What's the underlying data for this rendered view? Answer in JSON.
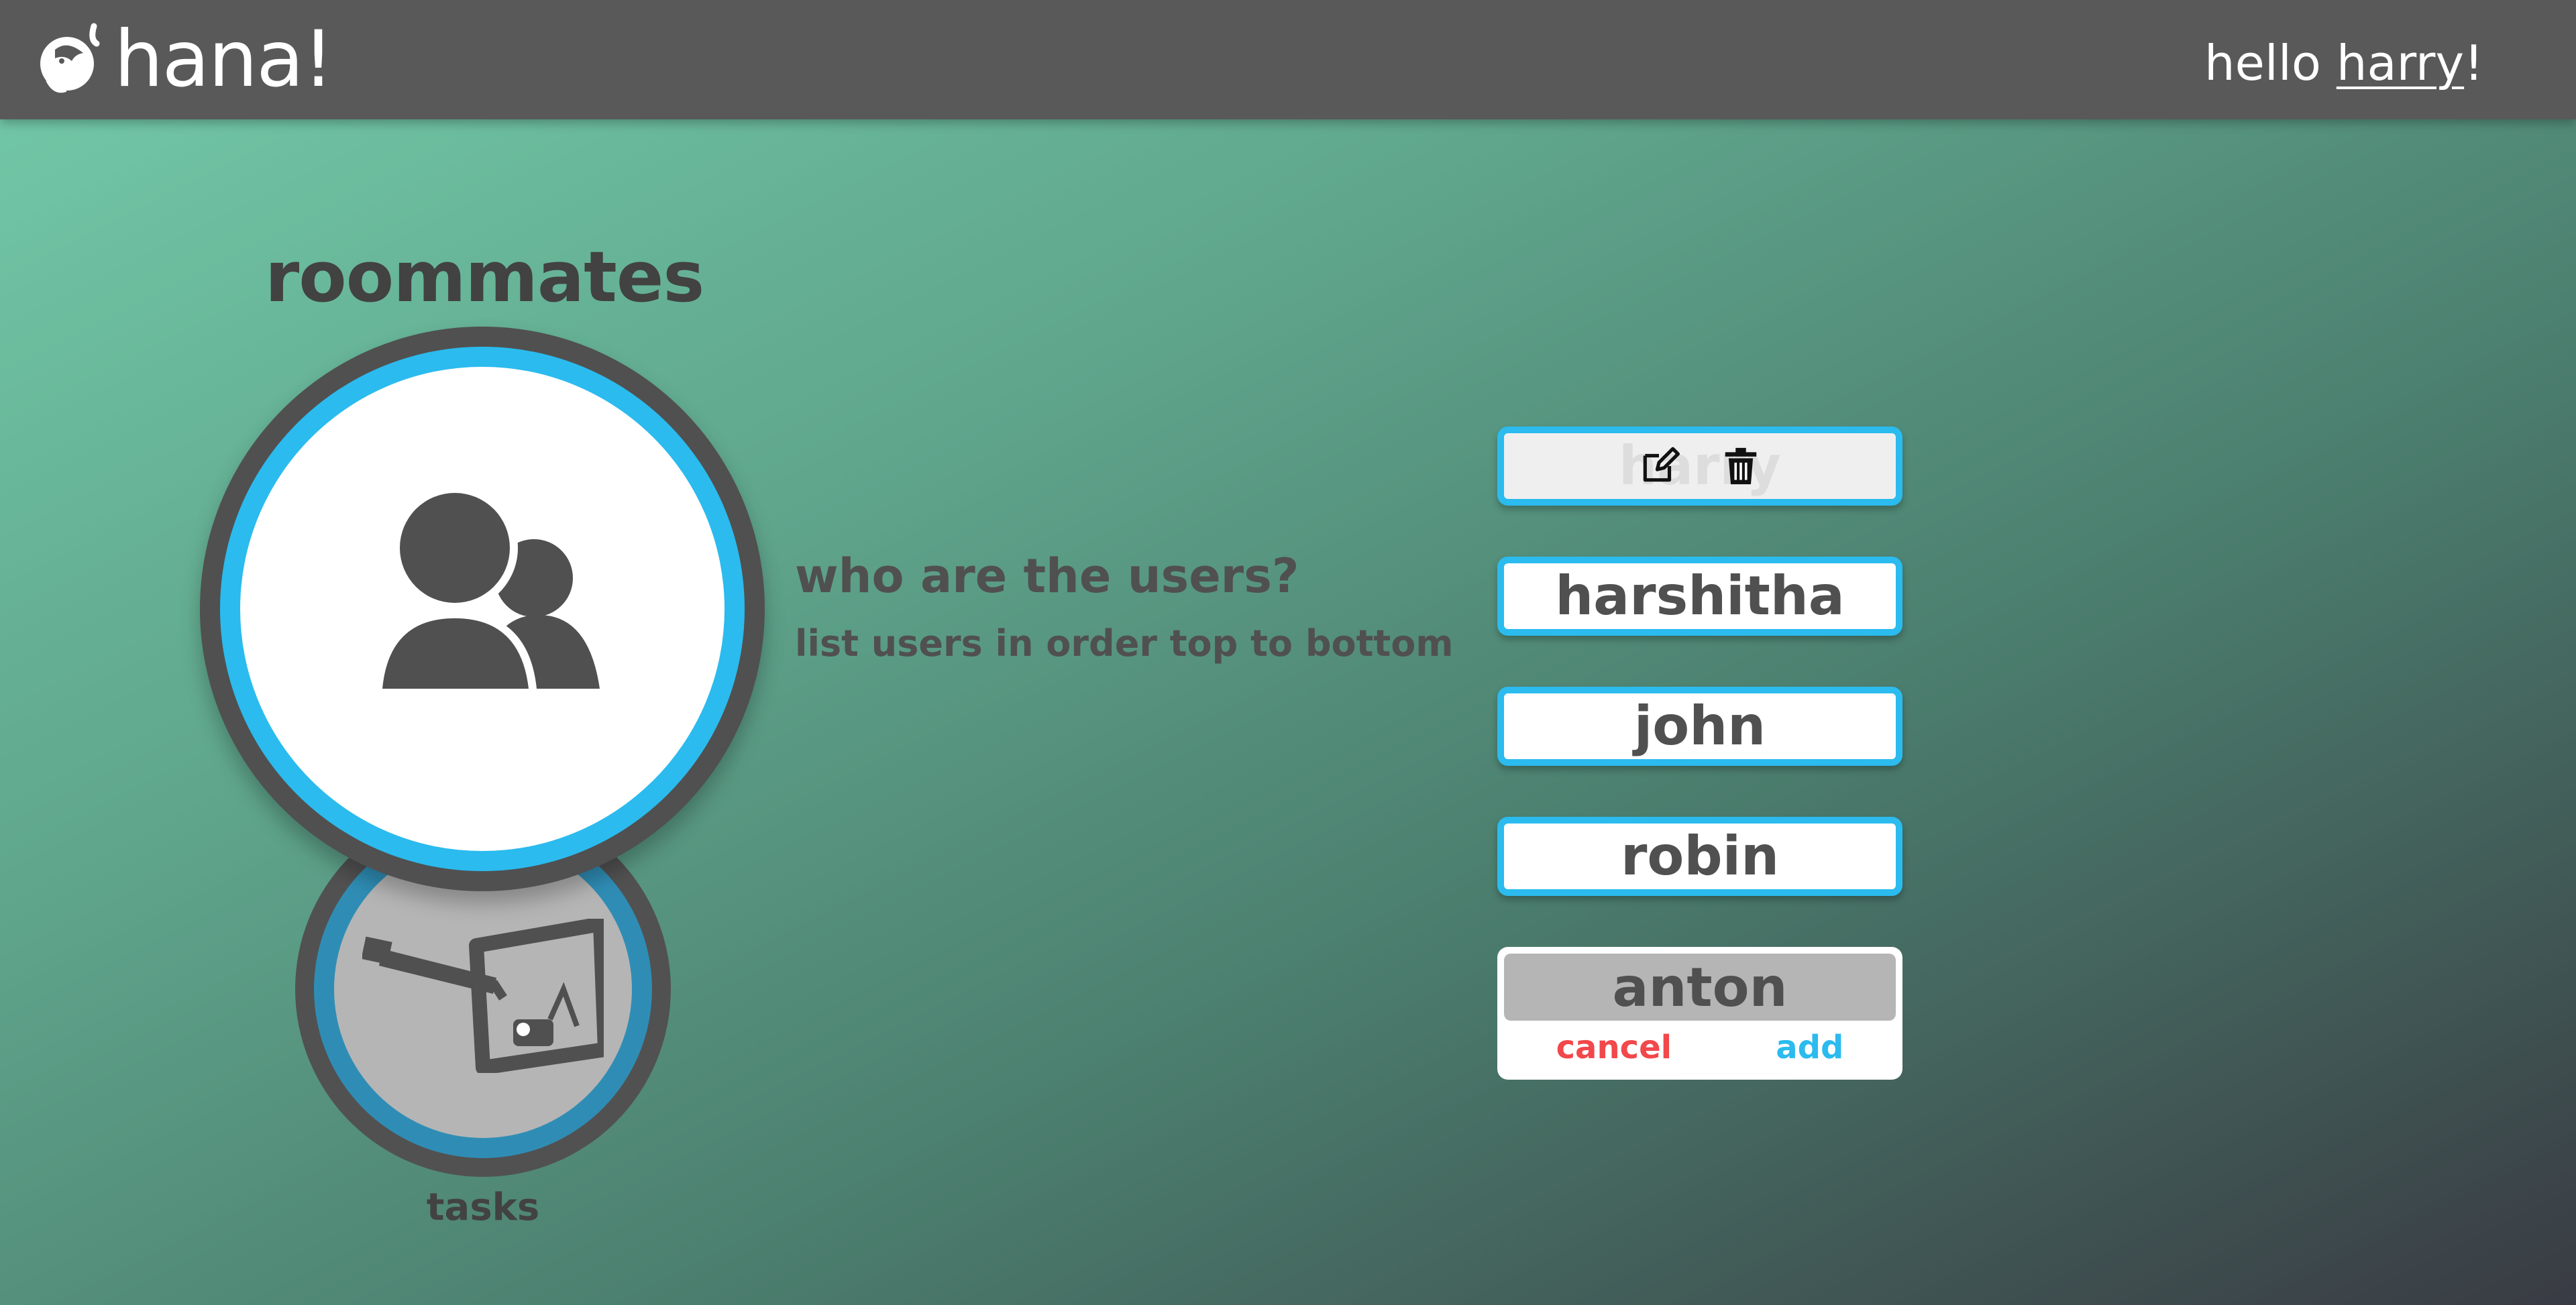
{
  "header": {
    "brand_name": "hana!",
    "greeting_prefix": "hello ",
    "username": "harry",
    "greeting_suffix": "!"
  },
  "section": {
    "title": "roommates",
    "prompt_title": "who are the users?",
    "prompt_subtitle": "list users in order top to bottom"
  },
  "nav": {
    "tasks_label": "tasks"
  },
  "users": [
    {
      "name": "harry"
    },
    {
      "name": "harshitha"
    },
    {
      "name": "john"
    },
    {
      "name": "robin"
    }
  ],
  "add_form": {
    "value": "anton",
    "cancel_label": "cancel",
    "add_label": "add"
  },
  "colors": {
    "accent": "#2bbbee",
    "danger": "#f2474b",
    "header": "#595959",
    "text_dark": "#505050"
  },
  "icons": {
    "logo": "dolphin-logo-icon",
    "roommates": "users-group-icon",
    "tasks": "vacuum-tasks-icon",
    "edit": "edit-icon",
    "delete": "trash-icon"
  }
}
